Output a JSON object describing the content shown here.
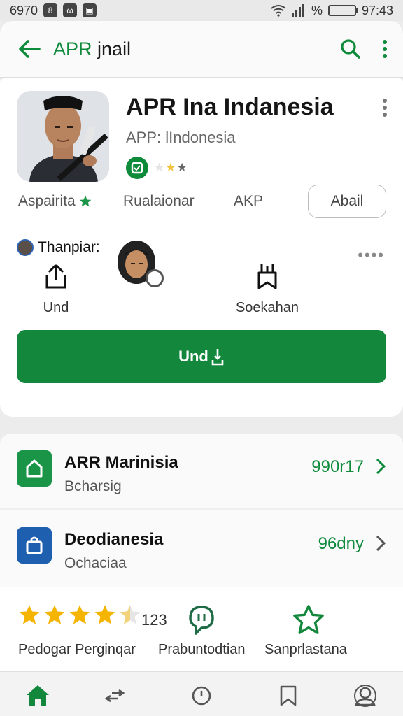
{
  "status_bar": {
    "left_text": "6970",
    "badges": [
      "8",
      "ω"
    ],
    "percent": "%",
    "time": "97:43"
  },
  "app_bar": {
    "title_prefix": "APR",
    "title_rest": " jnail",
    "accent_color": "#0e8a3b"
  },
  "app": {
    "name": "APR Ina Indanesia",
    "subtitle": "APP: lIndonesia",
    "rating_stars": 2,
    "meta": [
      "Aspairita",
      "Rualaionar",
      "AKP"
    ],
    "about_label": "Abail"
  },
  "shared": {
    "label": "Thanpiar:",
    "share_label": "Und",
    "save_label": "Soekahan"
  },
  "install": {
    "label": "Und",
    "color": "#13883d"
  },
  "list": [
    {
      "title": "ARR Marinisia",
      "subtitle": "Bcharsig",
      "count": "990r17",
      "icon_color": "#1a9447",
      "icon": "house-icon"
    },
    {
      "title": "Deodianesia",
      "subtitle": "Ochaciaa",
      "count": "96dny",
      "icon_color": "#1f5fb0",
      "icon": "bag-icon"
    }
  ],
  "rating": {
    "value": 4.5,
    "count": "123",
    "labels": [
      "Pedogar Perginqar",
      "Prabuntodtian",
      "Sanprlastana"
    ]
  },
  "nav": [
    "home-icon",
    "swap-icon",
    "clock-icon",
    "bookmark-icon",
    "profile-icon"
  ]
}
